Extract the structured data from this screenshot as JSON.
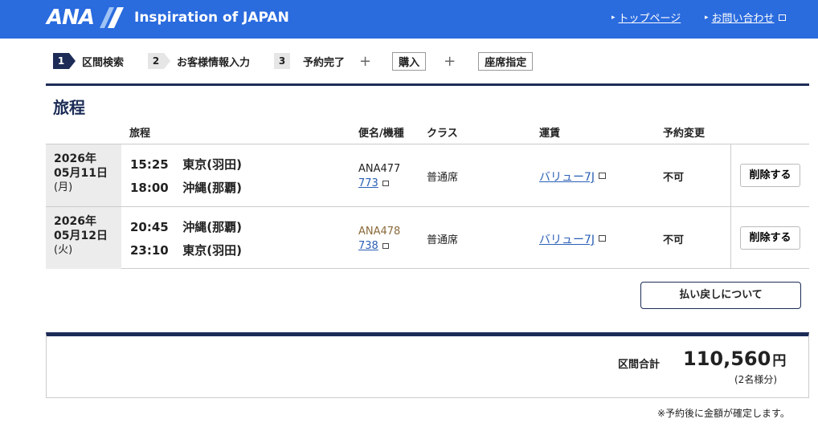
{
  "header": {
    "logo": "ANA",
    "tagline": "Inspiration of JAPAN",
    "nav": [
      {
        "label": "トップページ"
      },
      {
        "label": "お問い合わせ"
      }
    ]
  },
  "steps": [
    {
      "num": "1",
      "label": "区間検索",
      "active": true
    },
    {
      "num": "2",
      "label": "お客様情報入力"
    },
    {
      "num": "3",
      "label": "予約完了"
    }
  ],
  "step_extras": [
    "購入",
    "座席指定"
  ],
  "itinerary": {
    "title": "旅程",
    "headers": {
      "itinerary": "旅程",
      "flight": "便名/機種",
      "class": "クラス",
      "fare": "運賃",
      "change": "予約変更"
    },
    "rows": [
      {
        "date_year": "2026年",
        "date_md": "05月11日",
        "date_dow": "(月)",
        "dep_time": "15:25",
        "dep_airport": "東京(羽田)",
        "arr_time": "18:00",
        "arr_airport": "沖縄(那覇)",
        "flight": "ANA477",
        "aircraft": "773",
        "class": "普通席",
        "fare": "バリュー7J",
        "change": "不可",
        "delete_label": "削除する"
      },
      {
        "date_year": "2026年",
        "date_md": "05月12日",
        "date_dow": "(火)",
        "dep_time": "20:45",
        "dep_airport": "沖縄(那覇)",
        "arr_time": "23:10",
        "arr_airport": "東京(羽田)",
        "flight": "ANA478",
        "aircraft": "738",
        "class": "普通席",
        "fare": "バリュー7J",
        "change": "不可",
        "delete_label": "削除する"
      }
    ]
  },
  "refund_button": "払い戻しについて",
  "total": {
    "label": "区間合計",
    "amount": "110,560",
    "currency": "円",
    "note": "(2名様分)"
  },
  "footnote": "※予約後に金額が確定します。",
  "colors": {
    "header_bg": "#2a6bde",
    "navy": "#1c2c56",
    "link": "#2a5fb5",
    "flight2_text": "#8a6a3a"
  }
}
